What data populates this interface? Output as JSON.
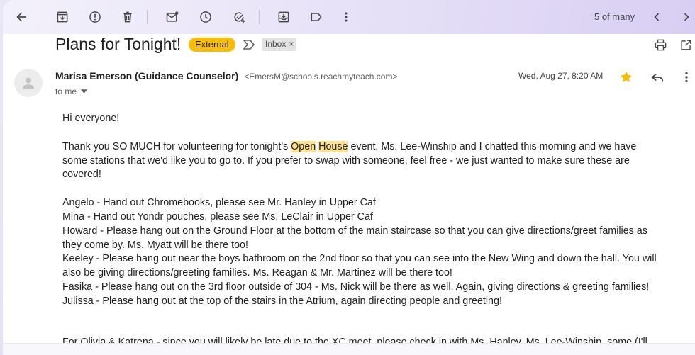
{
  "toolbar": {
    "icons": [
      "back-arrow-icon",
      "archive-icon",
      "report-spam-icon",
      "delete-icon",
      "mark-unread-icon",
      "snooze-icon",
      "add-to-tasks-icon",
      "move-to-icon",
      "label-icon",
      "more-vert-icon",
      "chevron-left-icon",
      "chevron-right-icon"
    ],
    "pager": "5 of many"
  },
  "subject": {
    "title": "Plans for Tonight!",
    "external_badge": "External",
    "inbox_chip": "Inbox",
    "chip_close": "×"
  },
  "colors": {
    "external_badge": "#fbbc04",
    "star": "#fbbc04",
    "search_highlight": "#fde293"
  },
  "message": {
    "sender_name": "Marisa Emerson (Guidance Counselor)",
    "sender_email": "<EmersM@schools.reachmyteach.com>",
    "to": "to me",
    "date": "Wed, Aug 27, 8:20 AM",
    "starred": true
  },
  "body": {
    "greeting": "Hi everyone!",
    "intro_before": "Thank you SO MUCH for volunteering for tonight's ",
    "hl1": "Open",
    "hl2": "House",
    "intro_after": " event. Ms. Lee-Winship and I chatted this morning and we have some stations that we'd like you to go to. If you prefer to swap with someone, feel free - we just wanted to make sure these are covered!",
    "assignments": [
      "Angelo - Hand out Chromebooks, please see Mr. Hanley in Upper Caf",
      "Mina - Hand out Yondr pouches, please see Ms. LeClair in Upper Caf",
      "Howard - Please hang out on the Ground Floor at the bottom of the main staircase so that you can give directions/greet families as they come by. Ms. Myatt will be there too!",
      "Keeley - Please hang out near the boys bathroom on the 2nd floor so that you can see into the New Wing and down the hall. You will also be giving directions/greeting families. Ms. Reagan & Mr. Martinez will be there too!",
      "Fasika - Please hang out on the 3rd floor outside of 304 - Ms. Nick will be there as well. Again, giving directions & greeting families!",
      "Julissa - Please hang out at the top of the stairs in the Atrium, again directing people and greeting!"
    ],
    "cut_line": "For Olivia & Katrena - since you will likely be late due to the XC meet, please check in with Ms. Hanley, Ms. Lee-Winship, some (I'll"
  }
}
